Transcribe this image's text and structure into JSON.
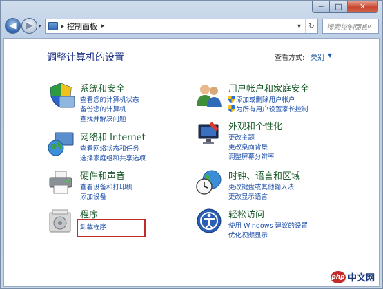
{
  "window": {
    "min": "─",
    "max": "□",
    "close": "✕"
  },
  "nav": {
    "back": "◀",
    "forward": "▶",
    "dropdown": "▾",
    "breadcrumb_sep": "▸",
    "breadcrumb": "控制面板",
    "breadcrumb_chevron": "▸",
    "addr_dropdown": "▾",
    "refresh": "↻",
    "search_placeholder": "搜索控制面板",
    "search_icon": "⌕"
  },
  "header": {
    "title": "调整计算机的设置",
    "view_by_label": "查看方式:",
    "view_by_value": "类别",
    "view_by_arrow": "▼"
  },
  "categories": [
    {
      "title": "系统和安全",
      "icon": "shield-icon",
      "links": [
        "查看您的计算机状态",
        "备份您的计算机",
        "查找并解决问题"
      ]
    },
    {
      "title": "用户帐户和家庭安全",
      "icon": "users-icon",
      "links": [
        "添加或删除用户帐户",
        "为所有用户设置家长控制"
      ]
    },
    {
      "title": "网络和 Internet",
      "icon": "globe-network-icon",
      "links": [
        "查看网络状态和任务",
        "选择家庭组和共享选项"
      ]
    },
    {
      "title": "外观和个性化",
      "icon": "display-icon",
      "links": [
        "更改主题",
        "更改桌面背景",
        "调整屏幕分辨率"
      ]
    },
    {
      "title": "硬件和声音",
      "icon": "printer-icon",
      "links": [
        "查看设备和打印机",
        "添加设备"
      ]
    },
    {
      "title": "时钟、语言和区域",
      "icon": "clock-globe-icon",
      "links": [
        "更改键盘或其他输入法",
        "更改显示语言"
      ]
    },
    {
      "title": "程序",
      "icon": "programs-icon",
      "links": [
        "卸载程序"
      ]
    },
    {
      "title": "轻松访问",
      "icon": "ease-access-icon",
      "links": [
        "使用 Windows 建议的设置",
        "优化视频显示"
      ]
    }
  ],
  "watermark": {
    "logo": "php",
    "text": "中文网"
  }
}
